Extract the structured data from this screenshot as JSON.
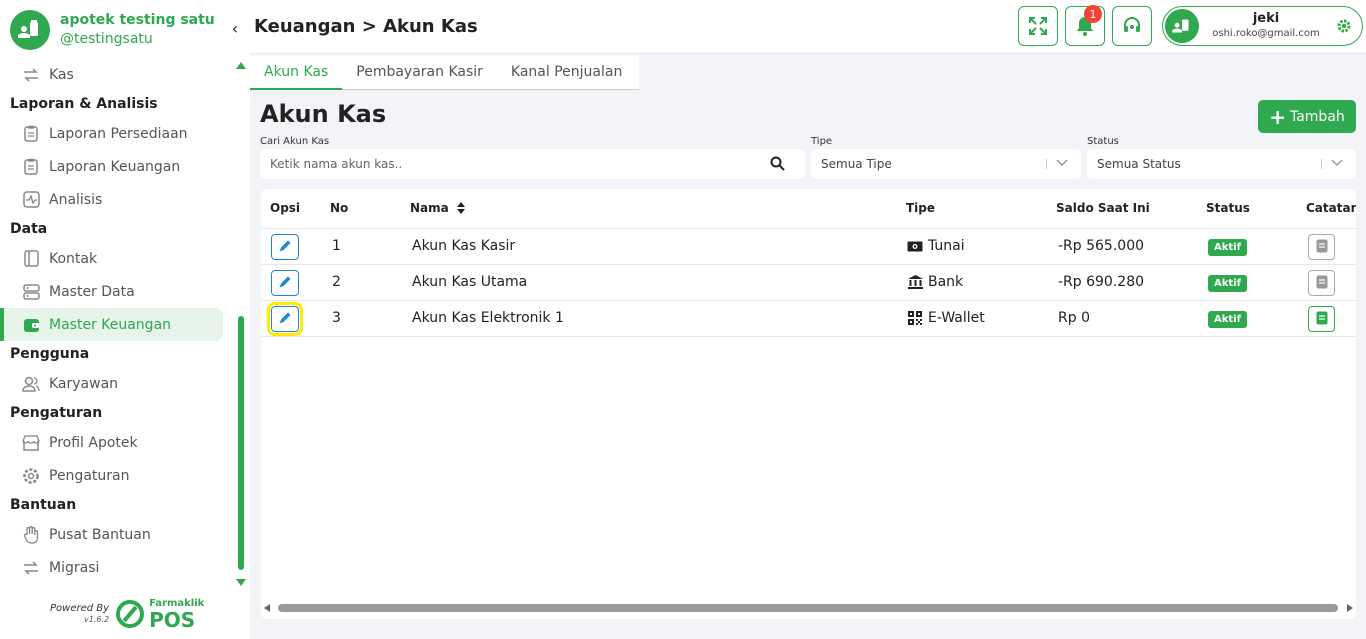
{
  "brand": {
    "name": "apotek testing satu",
    "handle": "@testingsatu"
  },
  "sidebar": {
    "items": [
      {
        "type": "item",
        "label": "Kas",
        "icon": "transfer-icon"
      },
      {
        "type": "section",
        "label": "Laporan & Analisis"
      },
      {
        "type": "item",
        "label": "Laporan Persediaan",
        "icon": "clipboard-icon"
      },
      {
        "type": "item",
        "label": "Laporan Keuangan",
        "icon": "clipboard-icon"
      },
      {
        "type": "item",
        "label": "Analisis",
        "icon": "activity-icon"
      },
      {
        "type": "section",
        "label": "Data"
      },
      {
        "type": "item",
        "label": "Kontak",
        "icon": "contact-book-icon"
      },
      {
        "type": "item",
        "label": "Master Data",
        "icon": "database-icon"
      },
      {
        "type": "item",
        "label": "Master Keuangan",
        "icon": "wallet-icon",
        "active": true
      },
      {
        "type": "section",
        "label": "Pengguna"
      },
      {
        "type": "item",
        "label": "Karyawan",
        "icon": "users-icon"
      },
      {
        "type": "section",
        "label": "Pengaturan"
      },
      {
        "type": "item",
        "label": "Profil Apotek",
        "icon": "store-icon"
      },
      {
        "type": "item",
        "label": "Pengaturan",
        "icon": "gear-icon"
      },
      {
        "type": "section",
        "label": "Bantuan"
      },
      {
        "type": "item",
        "label": "Pusat Bantuan",
        "icon": "hand-icon"
      },
      {
        "type": "item",
        "label": "Migrasi",
        "icon": "transfer-icon"
      }
    ]
  },
  "footer": {
    "powered_by": "Powered By",
    "version": "v1.6.2",
    "logo_name": "Farmaklik",
    "logo_pos": "POS"
  },
  "header": {
    "breadcrumb": "Keuangan > Akun Kas",
    "notification_count": "1",
    "user_name": "jeki",
    "user_email": "oshi.roko@gmail.com"
  },
  "tabs": [
    {
      "label": "Akun Kas",
      "active": true
    },
    {
      "label": "Pembayaran Kasir",
      "active": false
    },
    {
      "label": "Kanal Penjualan",
      "active": false
    }
  ],
  "page": {
    "title": "Akun Kas",
    "add_label": "Tambah"
  },
  "filters": {
    "search_label": "Cari Akun Kas",
    "search_placeholder": "Ketik nama akun kas..",
    "tipe_label": "Tipe",
    "tipe_value": "Semua Tipe",
    "status_label": "Status",
    "status_value": "Semua Status"
  },
  "table": {
    "headers": {
      "opsi": "Opsi",
      "no": "No",
      "nama": "Nama",
      "tipe": "Tipe",
      "saldo": "Saldo Saat Ini",
      "status": "Status",
      "catatan": "Catatan"
    },
    "rows": [
      {
        "no": "1",
        "nama": "Akun Kas Kasir",
        "tipe": "Tunai",
        "tipe_icon": "cash-icon",
        "saldo": "-Rp 565.000",
        "status": "Aktif"
      },
      {
        "no": "2",
        "nama": "Akun Kas Utama",
        "tipe": "Bank",
        "tipe_icon": "bank-icon",
        "saldo": "-Rp 690.280",
        "status": "Aktif"
      },
      {
        "no": "3",
        "nama": "Akun Kas Elektronik 1",
        "tipe": "E-Wallet",
        "tipe_icon": "qr-code-icon",
        "saldo": "Rp 0",
        "status": "Aktif"
      }
    ]
  },
  "colors": {
    "primary": "#2fa84f",
    "edit": "#1e88c9",
    "badge": "#f44336",
    "highlight": "#ffeb00"
  }
}
